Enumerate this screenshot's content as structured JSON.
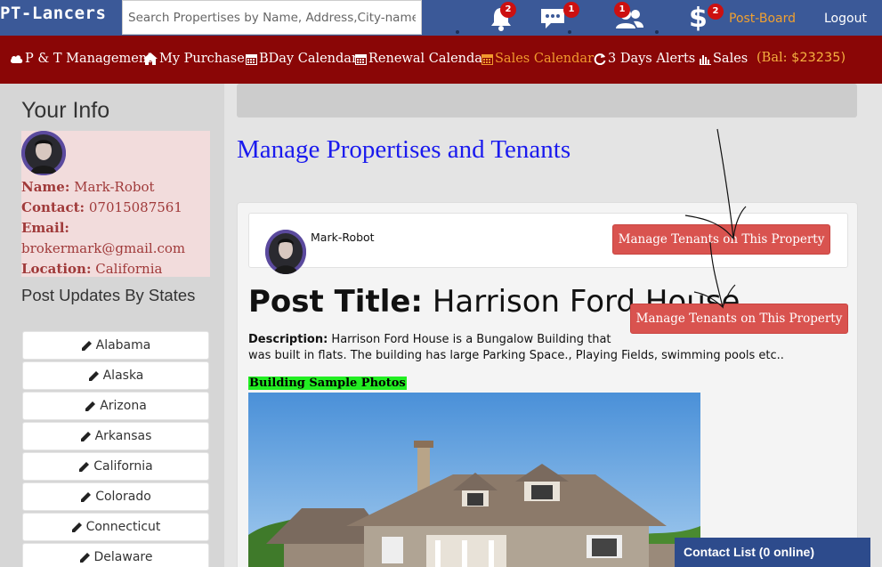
{
  "topbar": {
    "brand": "PT-Lancers",
    "search_placeholder": "Search Propertises by Name, Address,City-name",
    "notifications_count": "2",
    "messages_count": "1",
    "friends_count": "1",
    "dollar_count": "2",
    "postboard_label": "Post-Board",
    "logout_label": "Logout",
    "colors": {
      "bar": "#3b5998",
      "badge": "#cc1010",
      "postboard": "#f0a030"
    }
  },
  "rednav": {
    "items": [
      {
        "label": "P & T Management",
        "icon": "cloud-icon"
      },
      {
        "label": "My Purchase",
        "icon": "home-icon"
      },
      {
        "label": "BDay Calendar",
        "icon": "calendar-icon"
      },
      {
        "label": "Renewal Calendar",
        "icon": "calendar-icon"
      },
      {
        "label": "Sales Calendar",
        "icon": "calendar-icon"
      },
      {
        "label": "3 Days Alerts",
        "icon": "refresh-icon"
      },
      {
        "label": "Sales",
        "icon": "bar-chart-icon"
      }
    ],
    "balance_label": "(Bal:",
    "balance_value": "$23235)",
    "colors": {
      "bar": "#8a0606",
      "orange": "#f29a2e"
    }
  },
  "sidebar": {
    "title": "Your Info",
    "info": {
      "name_label": "Name:",
      "name": "Mark-Robot",
      "contact_label": "Contact:",
      "contact": "07015087561",
      "email_label": "Email:",
      "email": "brokermark@gmail.com",
      "location_label": "Location:",
      "location": "California"
    },
    "post_updates_title": "Post Updates By States",
    "states": [
      "Alabama",
      "Alaska",
      "Arizona",
      "Arkansas",
      "California",
      "Colorado",
      "Connecticut",
      "Delaware"
    ]
  },
  "main": {
    "title": "Manage Propertises and Tenants",
    "owner_name": "Mark-Robot",
    "manage_btn_1": "Manage Tenants on This Property",
    "manage_btn_2": "Manage Tenants on This Property",
    "post_title_label": "Post Title:",
    "post_title": "Harrison Ford House",
    "description_label": "Description:",
    "description_line1": "Harrison Ford House is a Bungalow Building that",
    "description_line2": "was built in flats. The building has large Parking Space., Playing Fields, swimming pools etc..",
    "photos_label": "Building Sample Photos"
  },
  "chat": {
    "label": "Contact List (0 online)"
  }
}
